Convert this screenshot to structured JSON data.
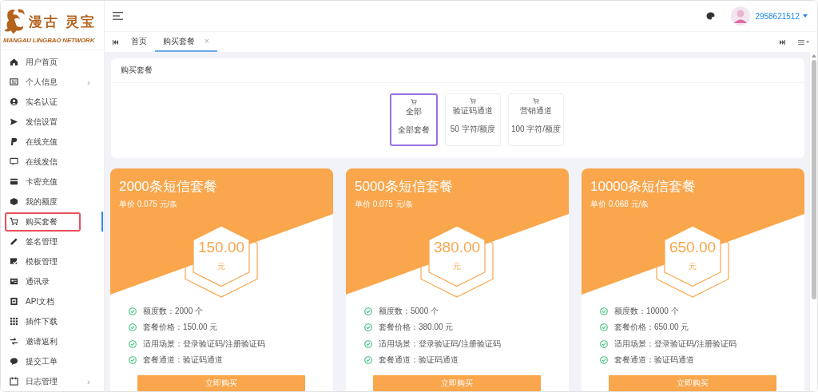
{
  "logo": {
    "title": "漫古 灵宝",
    "subtitle": "MANGAU LINGBAO NETWORK"
  },
  "sidebar": {
    "items": [
      {
        "label": "用户首页",
        "selected": false
      },
      {
        "label": "个人信息",
        "submenu_mark": "›",
        "selected": false
      },
      {
        "label": "实名认证",
        "selected": false
      },
      {
        "label": "发信设置",
        "selected": false
      },
      {
        "label": "在线充值",
        "selected": false
      },
      {
        "label": "在线发信",
        "selected": false
      },
      {
        "label": "卡密充值",
        "selected": false
      },
      {
        "label": "我的额度",
        "selected": false
      },
      {
        "label": "购买套餐",
        "selected": true
      },
      {
        "label": "签名管理",
        "selected": false
      },
      {
        "label": "模板管理",
        "selected": false
      },
      {
        "label": "通讯录",
        "selected": false
      },
      {
        "label": "API文档",
        "selected": false
      },
      {
        "label": "插件下载",
        "selected": false
      },
      {
        "label": "邀请返利",
        "selected": false
      },
      {
        "label": "提交工单",
        "selected": false
      },
      {
        "label": "日志管理",
        "submenu_mark": "›",
        "selected": false
      }
    ]
  },
  "header": {
    "username": "2958621512"
  },
  "tabs": [
    {
      "label": "首页",
      "selected": false
    },
    {
      "label": "购买套餐",
      "selected": true,
      "close": "×"
    }
  ],
  "panel": {
    "title": "购买套餐",
    "filters": [
      {
        "name": "全部",
        "description": "全部套餐",
        "selected": true
      },
      {
        "name": "验证码通道",
        "description": "50 字符/额度",
        "selected": false
      },
      {
        "name": "营销通道",
        "description": "100 字符/额度",
        "selected": false
      }
    ]
  },
  "packages": [
    {
      "title": "2000条短信套餐",
      "unit_price": "单价 0.075 元/条",
      "price": "150.00",
      "currency": "元",
      "features": [
        "额度数：2000 个",
        "套餐价格：150.00 元",
        "适用场景：登录验证码/注册验证码",
        "套餐通道：验证码通道"
      ],
      "button": "立即购买"
    },
    {
      "title": "5000条短信套餐",
      "unit_price": "单价 0.075 元/条",
      "price": "380.00",
      "currency": "元",
      "features": [
        "额度数：5000 个",
        "套餐价格：380.00 元",
        "适用场景：登录验证码/注册验证码",
        "套餐通道：验证码通道"
      ],
      "button": "立即购买"
    },
    {
      "title": "10000条短信套餐",
      "unit_price": "单价 0.068 元/条",
      "price": "650.00",
      "currency": "元",
      "features": [
        "额度数：10000 个",
        "套餐价格：650.00 元",
        "适用场景：登录验证码/注册验证码",
        "套餐通道：验证码通道"
      ],
      "button": "立即购买"
    }
  ]
}
